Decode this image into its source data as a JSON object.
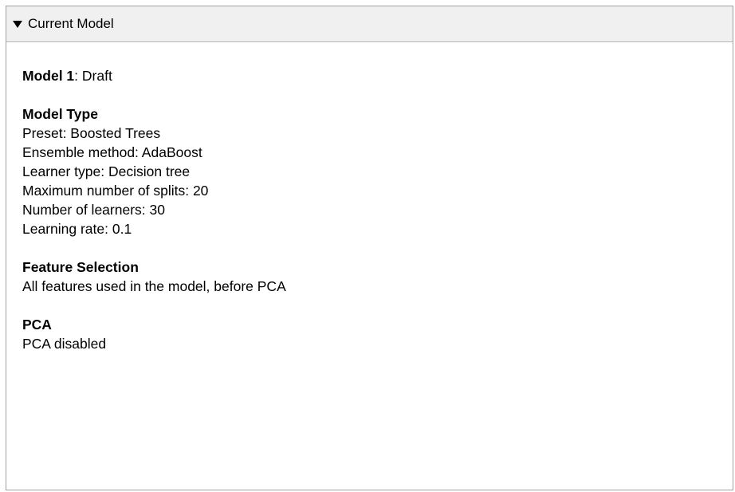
{
  "header": {
    "title": "Current Model",
    "toggle_icon": "caret-down-icon"
  },
  "model": {
    "name_label": "Model 1",
    "name_sep": ": ",
    "status": "Draft"
  },
  "model_type": {
    "heading": "Model Type",
    "lines": [
      "Preset: Boosted Trees",
      "Ensemble method: AdaBoost",
      "Learner type: Decision tree",
      "Maximum number of splits: 20",
      "Number of learners: 30",
      "Learning rate: 0.1"
    ]
  },
  "feature_selection": {
    "heading": "Feature Selection",
    "text": "All features used in the model, before PCA"
  },
  "pca": {
    "heading": "PCA",
    "text": "PCA disabled"
  }
}
